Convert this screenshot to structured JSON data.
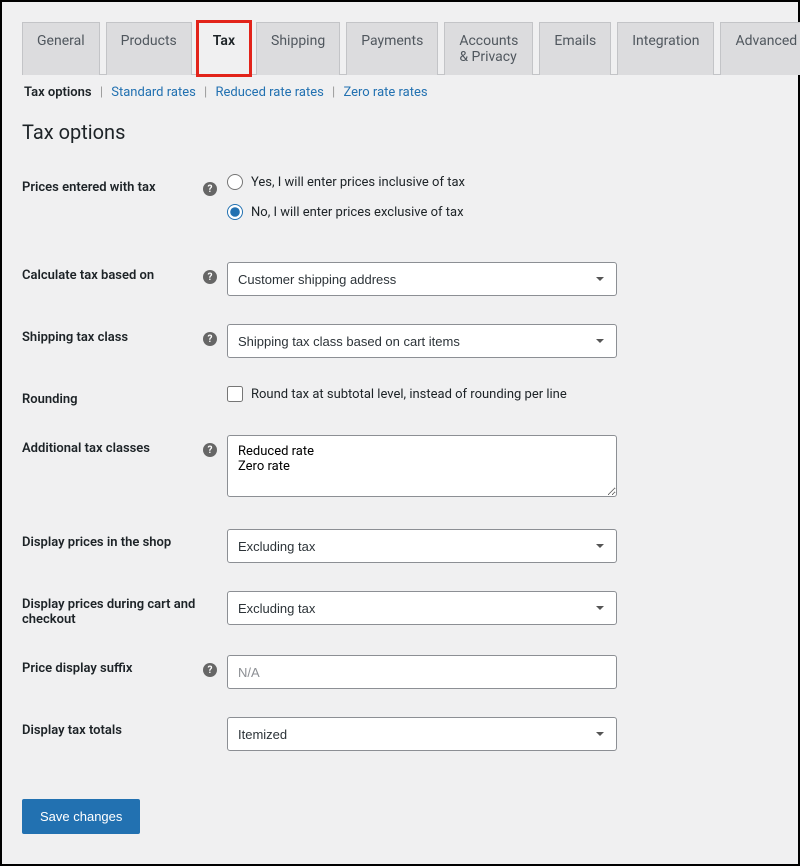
{
  "tabs": {
    "general": "General",
    "products": "Products",
    "tax": "Tax",
    "shipping": "Shipping",
    "payments": "Payments",
    "accounts": "Accounts & Privacy",
    "emails": "Emails",
    "integration": "Integration",
    "advanced": "Advanced"
  },
  "subtabs": {
    "tax_options": "Tax options",
    "standard_rates": "Standard rates",
    "reduced_rate_rates": "Reduced rate rates",
    "zero_rate_rates": "Zero rate rates"
  },
  "section_title": "Tax options",
  "rows": {
    "prices_entered": {
      "label": "Prices entered with tax",
      "option_yes": "Yes, I will enter prices inclusive of tax",
      "option_no": "No, I will enter prices exclusive of tax"
    },
    "calc_tax": {
      "label": "Calculate tax based on",
      "value": "Customer shipping address"
    },
    "shipping_tax_class": {
      "label": "Shipping tax class",
      "value": "Shipping tax class based on cart items"
    },
    "rounding": {
      "label": "Rounding",
      "option": "Round tax at subtotal level, instead of rounding per line"
    },
    "additional_tax_classes": {
      "label": "Additional tax classes",
      "value": "Reduced rate\nZero rate"
    },
    "display_shop": {
      "label": "Display prices in the shop",
      "value": "Excluding tax"
    },
    "display_cart": {
      "label": "Display prices during cart and checkout",
      "value": "Excluding tax"
    },
    "price_suffix": {
      "label": "Price display suffix",
      "placeholder": "N/A"
    },
    "display_tax_totals": {
      "label": "Display tax totals",
      "value": "Itemized"
    }
  },
  "help_char": "?",
  "save_button": "Save changes"
}
